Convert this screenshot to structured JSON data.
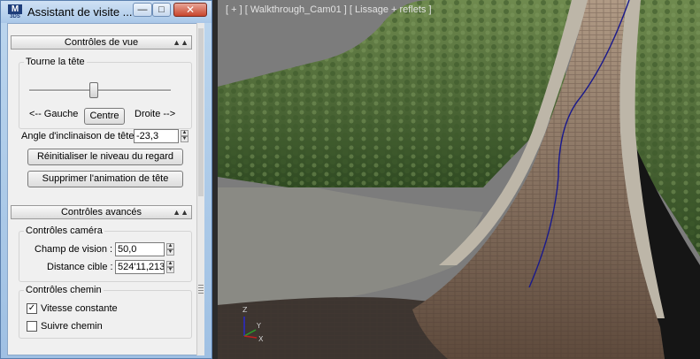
{
  "window": {
    "title": "Assistant de visite ...",
    "close_glyph": "✕",
    "min_glyph": "—",
    "max_glyph": "□"
  },
  "view_rollout": {
    "header": "Contrôles de vue",
    "head_turn": {
      "group_label": "Tourne la tête",
      "slider_level": 0.45,
      "left_label": "<-- Gauche",
      "center_button": "Centre",
      "right_label": "Droite -->"
    },
    "tilt": {
      "label": "Angle d'inclinaison de tête",
      "value": "-23,3"
    },
    "reset_button": "Réinitialiser le niveau du regard",
    "delete_button": "Supprimer l'animation de tête"
  },
  "advanced_rollout": {
    "header": "Contrôles avancés",
    "camera": {
      "group_label": "Contrôles caméra",
      "fov_label": "Champ de vision :",
      "fov_value": "50,0",
      "target_label": "Distance cible :",
      "target_value": "524'11,213"
    },
    "path": {
      "group_label": "Contrôles chemin",
      "constant_speed": {
        "label": "Vitesse constante",
        "checked": true
      },
      "follow_path": {
        "label": "Suivre chemin",
        "checked": false
      }
    }
  },
  "viewport": {
    "label": "[ + ] [ Walkthrough_Cam01 ] [ Lissage + reflets ]",
    "gizmo_axes": [
      "Z",
      "Y",
      "X"
    ],
    "colors": {
      "path_line": "#1a1a8c",
      "terrain": "#4e6e3a",
      "road": "#8a7060"
    }
  }
}
